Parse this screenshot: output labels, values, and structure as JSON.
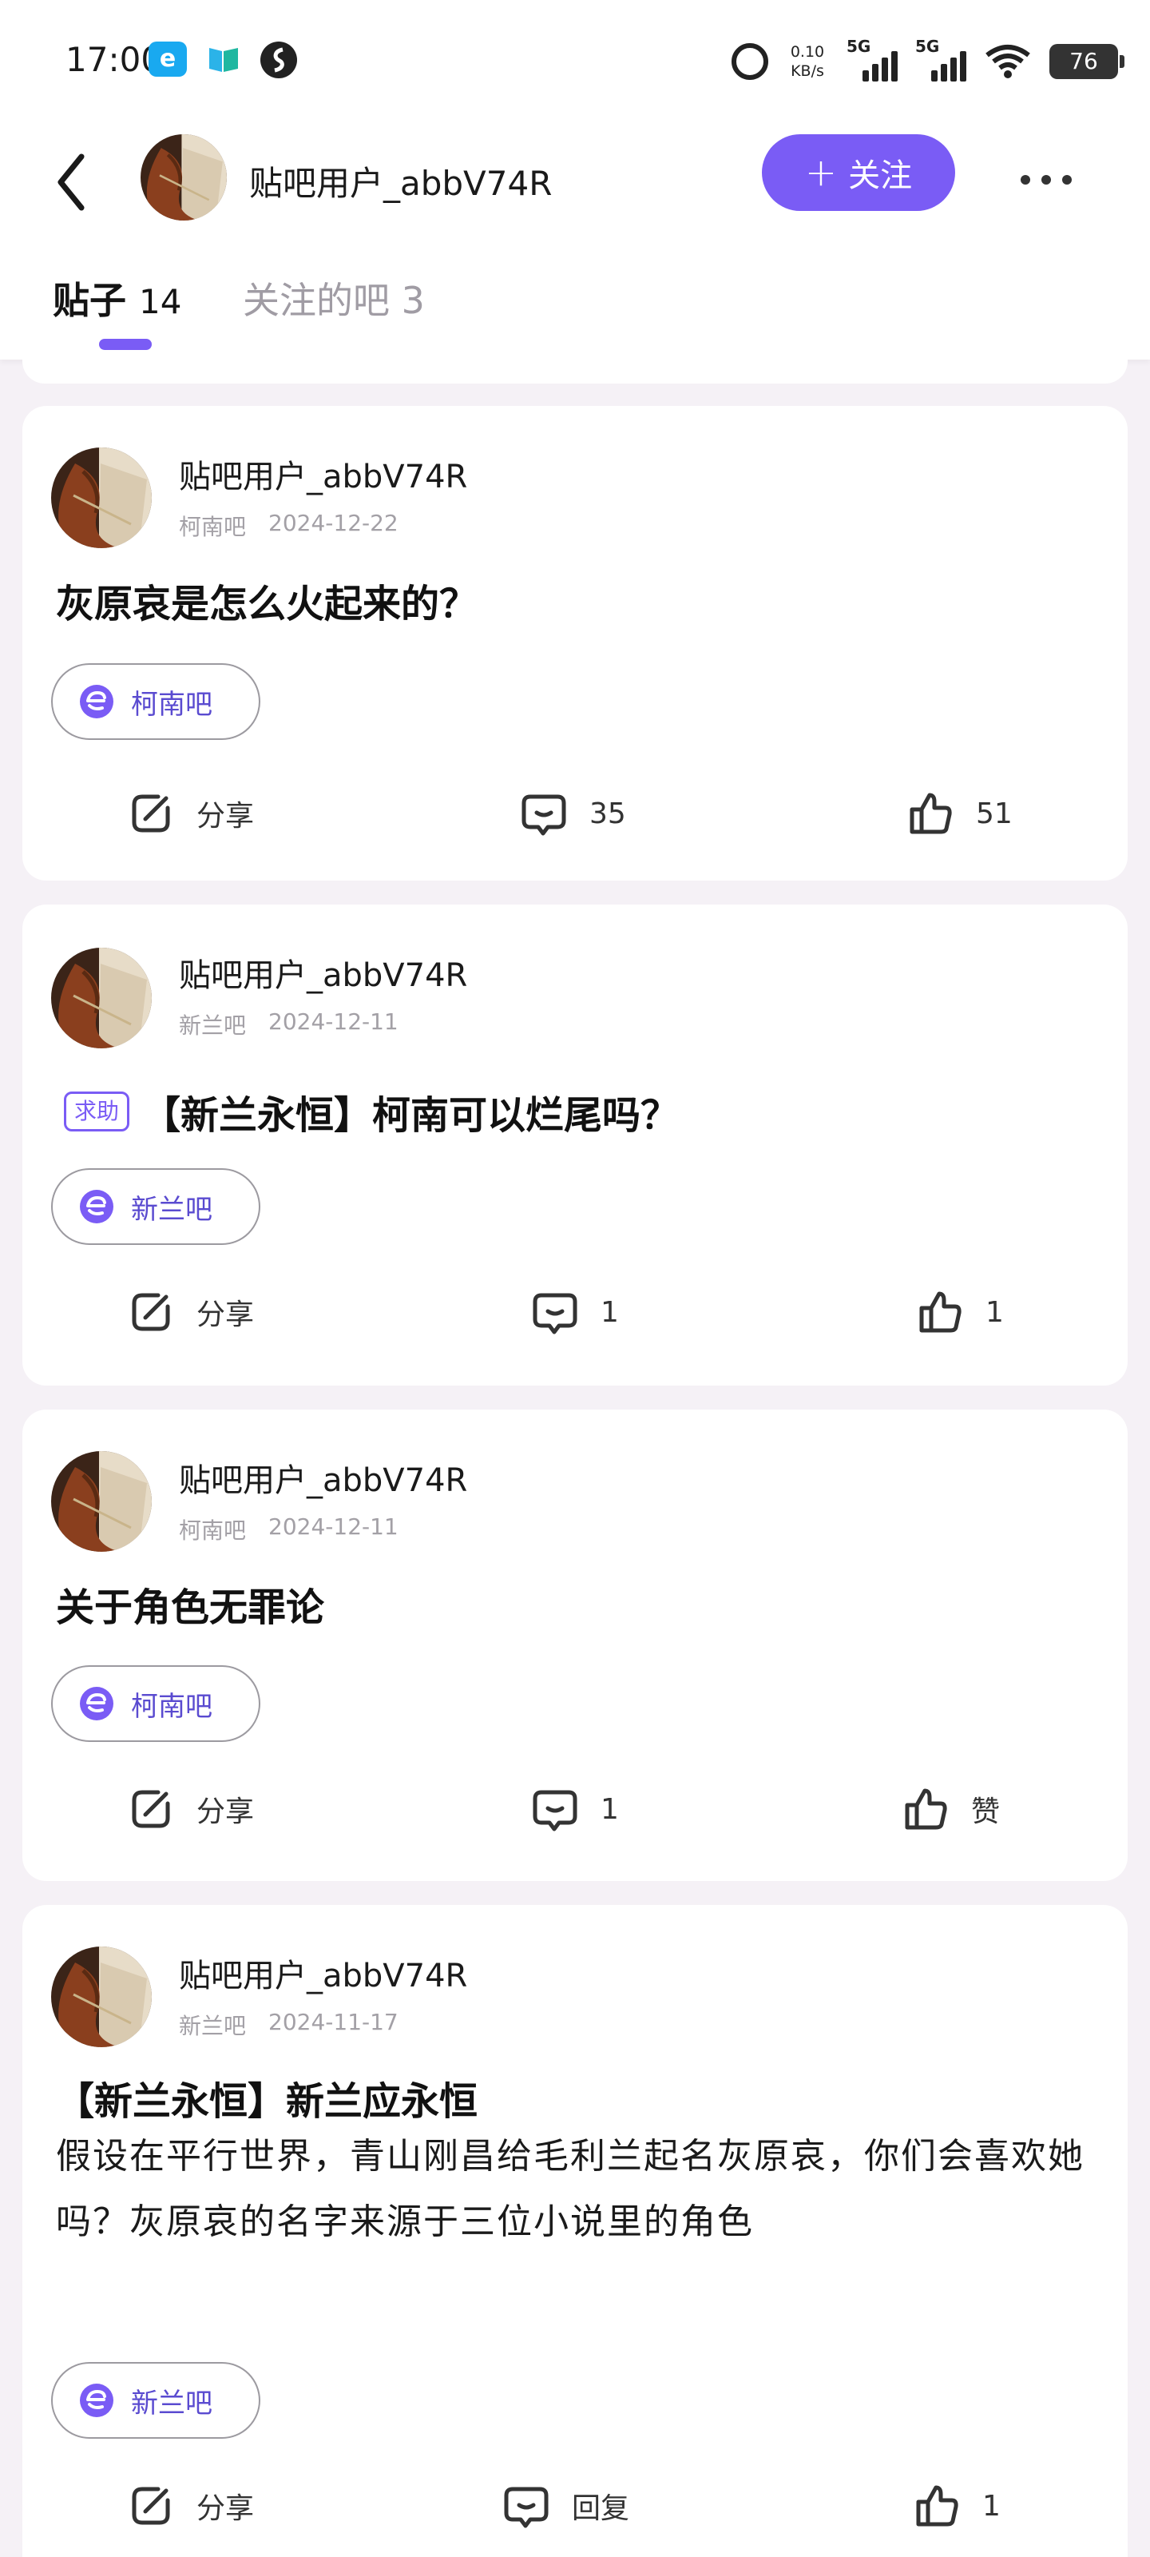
{
  "status_bar": {
    "time": "17:00",
    "net_speed_value": "0.10",
    "net_speed_unit": "KB/s",
    "sim1": "5G",
    "sim2": "5G",
    "battery": "76",
    "icons": [
      "app-e-icon",
      "app-flag-icon",
      "app-s-icon",
      "alarm-icon",
      "signal-icon",
      "wifi-icon",
      "battery-icon"
    ]
  },
  "header": {
    "username": "贴吧用户_abbV74R",
    "follow_label": "关注",
    "icons": [
      "back-arrow-icon",
      "plus-icon",
      "more-icon"
    ]
  },
  "tabs": [
    {
      "label": "贴子",
      "count": "14",
      "active": true
    },
    {
      "label": "关注的吧",
      "count": "3",
      "active": false
    }
  ],
  "colors": {
    "accent": "#7a5cf5",
    "background": "#f5f1f6",
    "card": "#ffffff",
    "meta_text": "#a3a0a6"
  },
  "posts": [
    {
      "user": "贴吧用户_abbV74R",
      "forum": "柯南吧",
      "date": "2024-12-22",
      "tag": "",
      "title": "灰原哀是怎么火起来的？",
      "body": "",
      "chip": "柯南吧",
      "share": "分享",
      "comments": "35",
      "likes": "51"
    },
    {
      "user": "贴吧用户_abbV74R",
      "forum": "新兰吧",
      "date": "2024-12-11",
      "tag": "求助",
      "title": "【新兰永恒】柯南可以烂尾吗？",
      "body": "",
      "chip": "新兰吧",
      "share": "分享",
      "comments": "1",
      "likes": "1"
    },
    {
      "user": "贴吧用户_abbV74R",
      "forum": "柯南吧",
      "date": "2024-12-11",
      "tag": "",
      "title": "关于角色无罪论",
      "body": "",
      "chip": "柯南吧",
      "share": "分享",
      "comments": "1",
      "likes": "赞"
    },
    {
      "user": "贴吧用户_abbV74R",
      "forum": "新兰吧",
      "date": "2024-11-17",
      "tag": "",
      "title": "【新兰永恒】新兰应永恒",
      "body": "假设在平行世界，青山刚昌给毛利兰起名灰原哀，你们会喜欢她吗？灰原哀的名字来源于三位小说里的角色",
      "chip": "新兰吧",
      "share": "分享",
      "comments": "回复",
      "likes": "1"
    }
  ]
}
